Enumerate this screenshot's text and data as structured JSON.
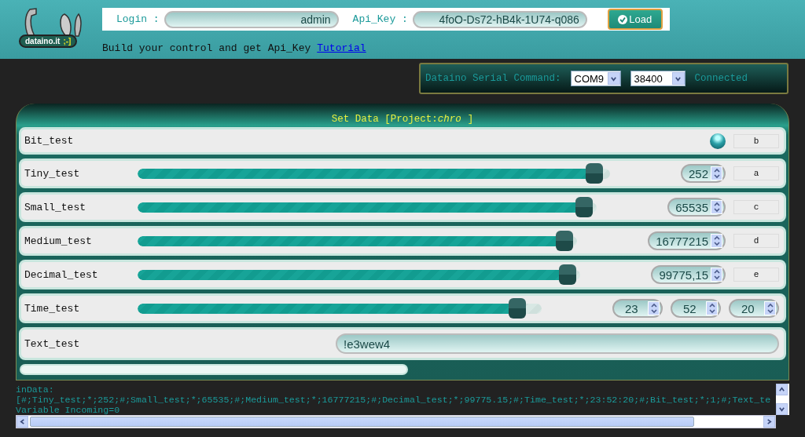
{
  "header": {
    "logo": {
      "name": "dataino.it",
      "smiley": ";-]"
    },
    "login": {
      "label": "Login :",
      "value": "admin"
    },
    "api_key": {
      "label": "Api_Key :",
      "value": "4foO-Ds72-hB4k-1U74-q086"
    },
    "load_button": "Load",
    "tagline": "Build your control and get Api_Key",
    "tutorial_link": "Tutorial"
  },
  "serial": {
    "label": "Dataino Serial Command:",
    "port": "COM9",
    "baud": "38400",
    "status": "Connected"
  },
  "panel": {
    "title": "Set Data [Project:",
    "project": "chro",
    "title_end": "]",
    "rows": [
      {
        "kind": "bit",
        "label": "Bit_test",
        "on": true,
        "key": "b"
      },
      {
        "kind": "slider",
        "label": "Tiny_test",
        "level": 0.985,
        "value": "252",
        "key": "a"
      },
      {
        "kind": "slider",
        "label": "Small_test",
        "level": 0.99,
        "value": "65535",
        "key": "c"
      },
      {
        "kind": "slider",
        "label": "Medium_test",
        "level": 0.99,
        "value": "16777215",
        "key": "d"
      },
      {
        "kind": "slider",
        "label": "Decimal_test",
        "level": 0.99,
        "value": "99775,15",
        "key": "e"
      },
      {
        "kind": "time",
        "label": "Time_test",
        "level": 0.96,
        "fields": [
          "23",
          "52",
          "20"
        ]
      },
      {
        "kind": "text",
        "label": "Text_test",
        "value": "!e3wew4"
      }
    ]
  },
  "log": {
    "lines": [
      "inData:",
      "[#;Tiny_test;*;252;#;Small_test;*;65535;#;Medium_test;*;16777215;#;Decimal_test;*;99775.15;#;Time_test;*;23:52:20;#;Bit_test;*;1;#;Text_te",
      "Variable Incoming=0"
    ]
  }
}
